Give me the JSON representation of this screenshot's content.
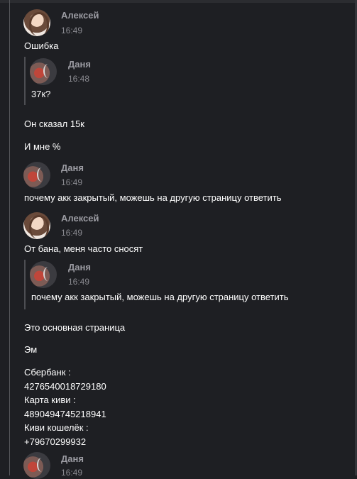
{
  "messages": {
    "m1": {
      "author": "Алексей",
      "time": "16:49",
      "text": "Ошибка"
    },
    "q1": {
      "author": "Даня",
      "time": "16:48",
      "text": "37к?"
    },
    "m2": {
      "text": "Он сказал 15к"
    },
    "m3": {
      "text": "И мне %"
    },
    "m4": {
      "author": "Даня",
      "time": "16:49",
      "text": "почему акк закрытый, можешь на другую страницу ответить"
    },
    "m5": {
      "author": "Алексей",
      "time": "16:49",
      "text": "От бана, меня часто сносят"
    },
    "q2": {
      "author": "Даня",
      "time": "16:49",
      "text": "почему акк закрытый, можешь на другую страницу ответить"
    },
    "m6": {
      "text": "Это основная страница"
    },
    "m7": {
      "text": "Эм"
    },
    "m8": {
      "lines": [
        "Сбербанк :",
        "4276540018729180",
        "Карта киви :",
        "4890494745218941",
        "Киви кошелёк :",
        "+79670299932"
      ]
    },
    "m9": {
      "author": "Даня",
      "time": "16:49"
    }
  },
  "colors": {
    "background": "#1e1f23",
    "name": "#9c9ca3",
    "time": "#8a8a90",
    "text": "#ffffff"
  }
}
